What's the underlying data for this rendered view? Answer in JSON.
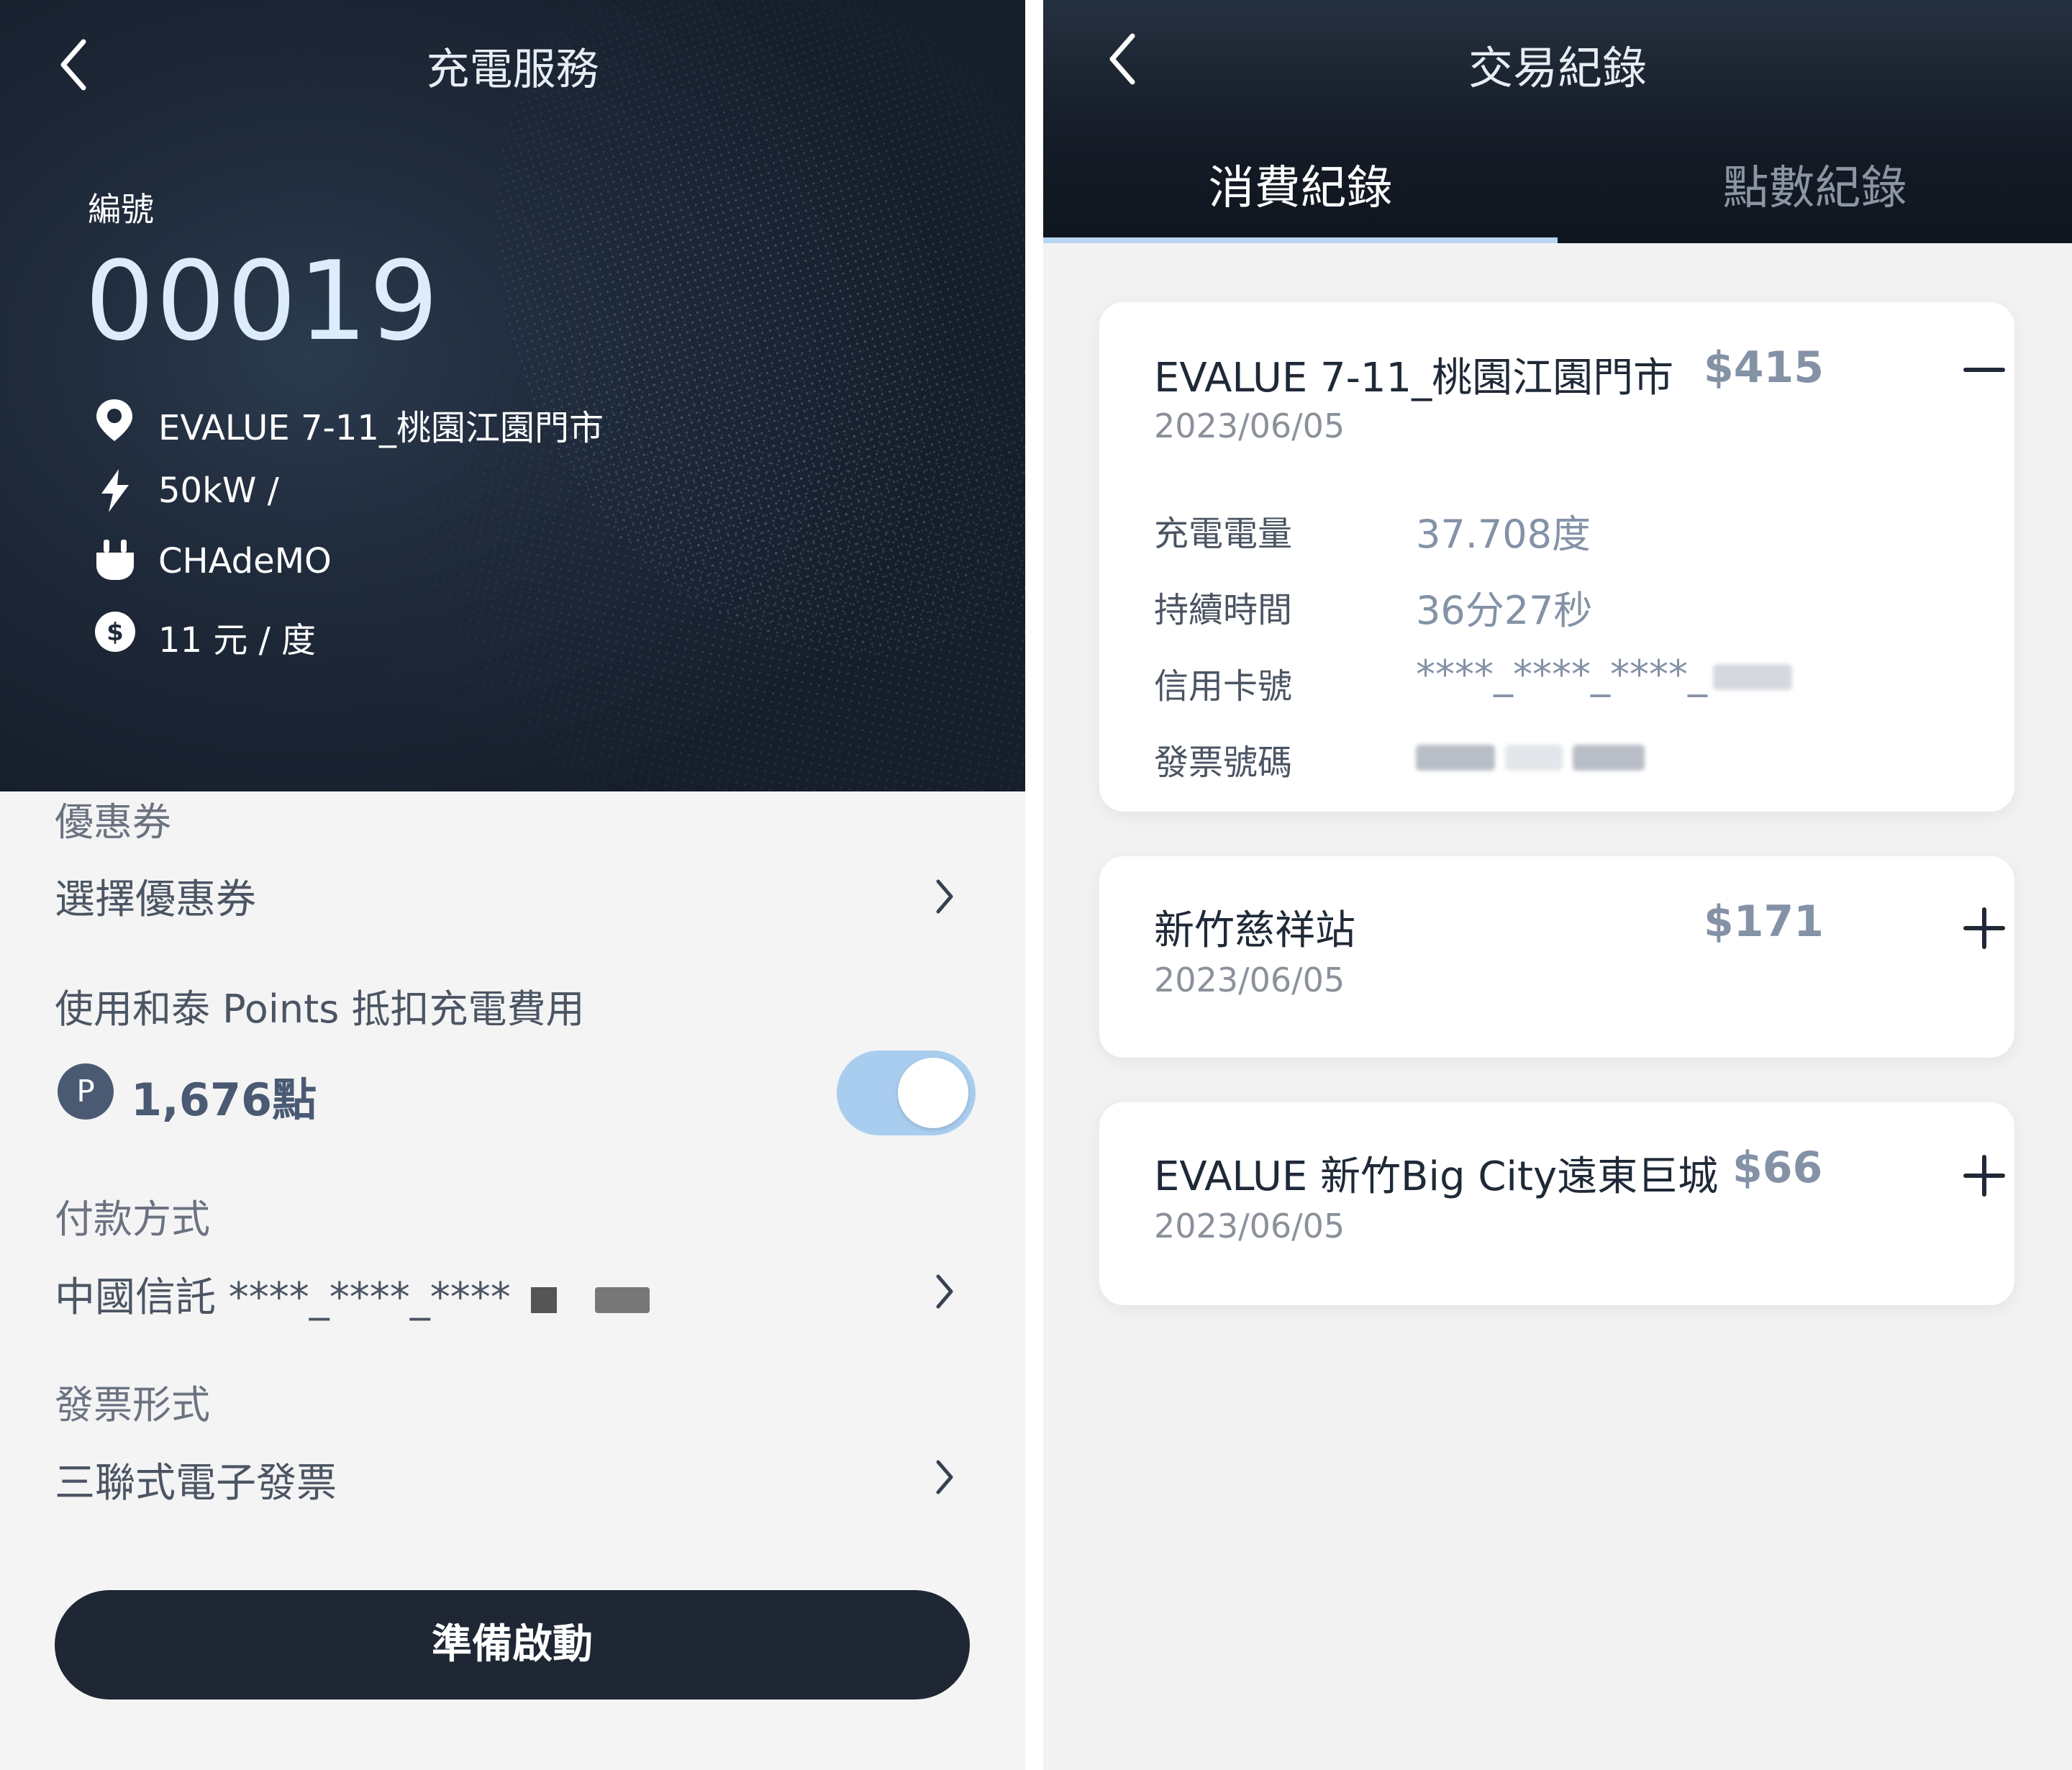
{
  "left": {
    "back_icon": "chevron-left-icon",
    "title": "充電服務",
    "id_label": "編號",
    "id_value": "00019",
    "info": [
      {
        "icon": "location-pin-icon",
        "text": "EVALUE 7-11_桃園江園門市"
      },
      {
        "icon": "lightning-icon",
        "text": "50kW /"
      },
      {
        "icon": "plug-icon",
        "text": "CHAdeMO"
      },
      {
        "icon": "dollar-icon",
        "text": "11 元 / 度"
      }
    ],
    "coupon_label": "優惠券",
    "coupon_select": "選擇優惠券",
    "points_label": "使用和泰 Points 抵扣充電費用",
    "points_badge": "P",
    "points_value": "1,676點",
    "points_toggle_on": true,
    "payment_label": "付款方式",
    "payment_value": "中國信託 ****_****_****",
    "invoice_label": "發票形式",
    "invoice_value": "三聯式電子發票",
    "start_button": "準備啟動",
    "colors": {
      "hero_bg": "#1c2533",
      "toggle": "#a9cdee",
      "button": "#1e2733"
    }
  },
  "right": {
    "back_icon": "chevron-left-icon",
    "title": "交易紀錄",
    "tabs": [
      {
        "label": "消費紀錄",
        "active": true
      },
      {
        "label": "點數紀錄",
        "active": false
      }
    ],
    "records": [
      {
        "name": "EVALUE 7-11_桃園江園門市",
        "amount": "$415",
        "date": "2023/06/05",
        "expanded": true,
        "toggle_icon": "minus-icon",
        "details": [
          {
            "label": "充電電量",
            "value": "37.708度"
          },
          {
            "label": "持續時間",
            "value": "36分27秒"
          },
          {
            "label": "信用卡號",
            "value": "****_****_****_"
          },
          {
            "label": "發票號碼",
            "value": ""
          }
        ]
      },
      {
        "name": "新竹慈祥站",
        "amount": "$171",
        "date": "2023/06/05",
        "expanded": false,
        "toggle_icon": "plus-icon"
      },
      {
        "name": "EVALUE 新竹Big City遠東巨城",
        "amount": "$66",
        "date": "2023/06/05",
        "expanded": false,
        "toggle_icon": "plus-icon"
      }
    ],
    "colors": {
      "header_bg": "#161d28",
      "tab_underline": "#b8d6f0",
      "amount": "#8492a6"
    }
  }
}
